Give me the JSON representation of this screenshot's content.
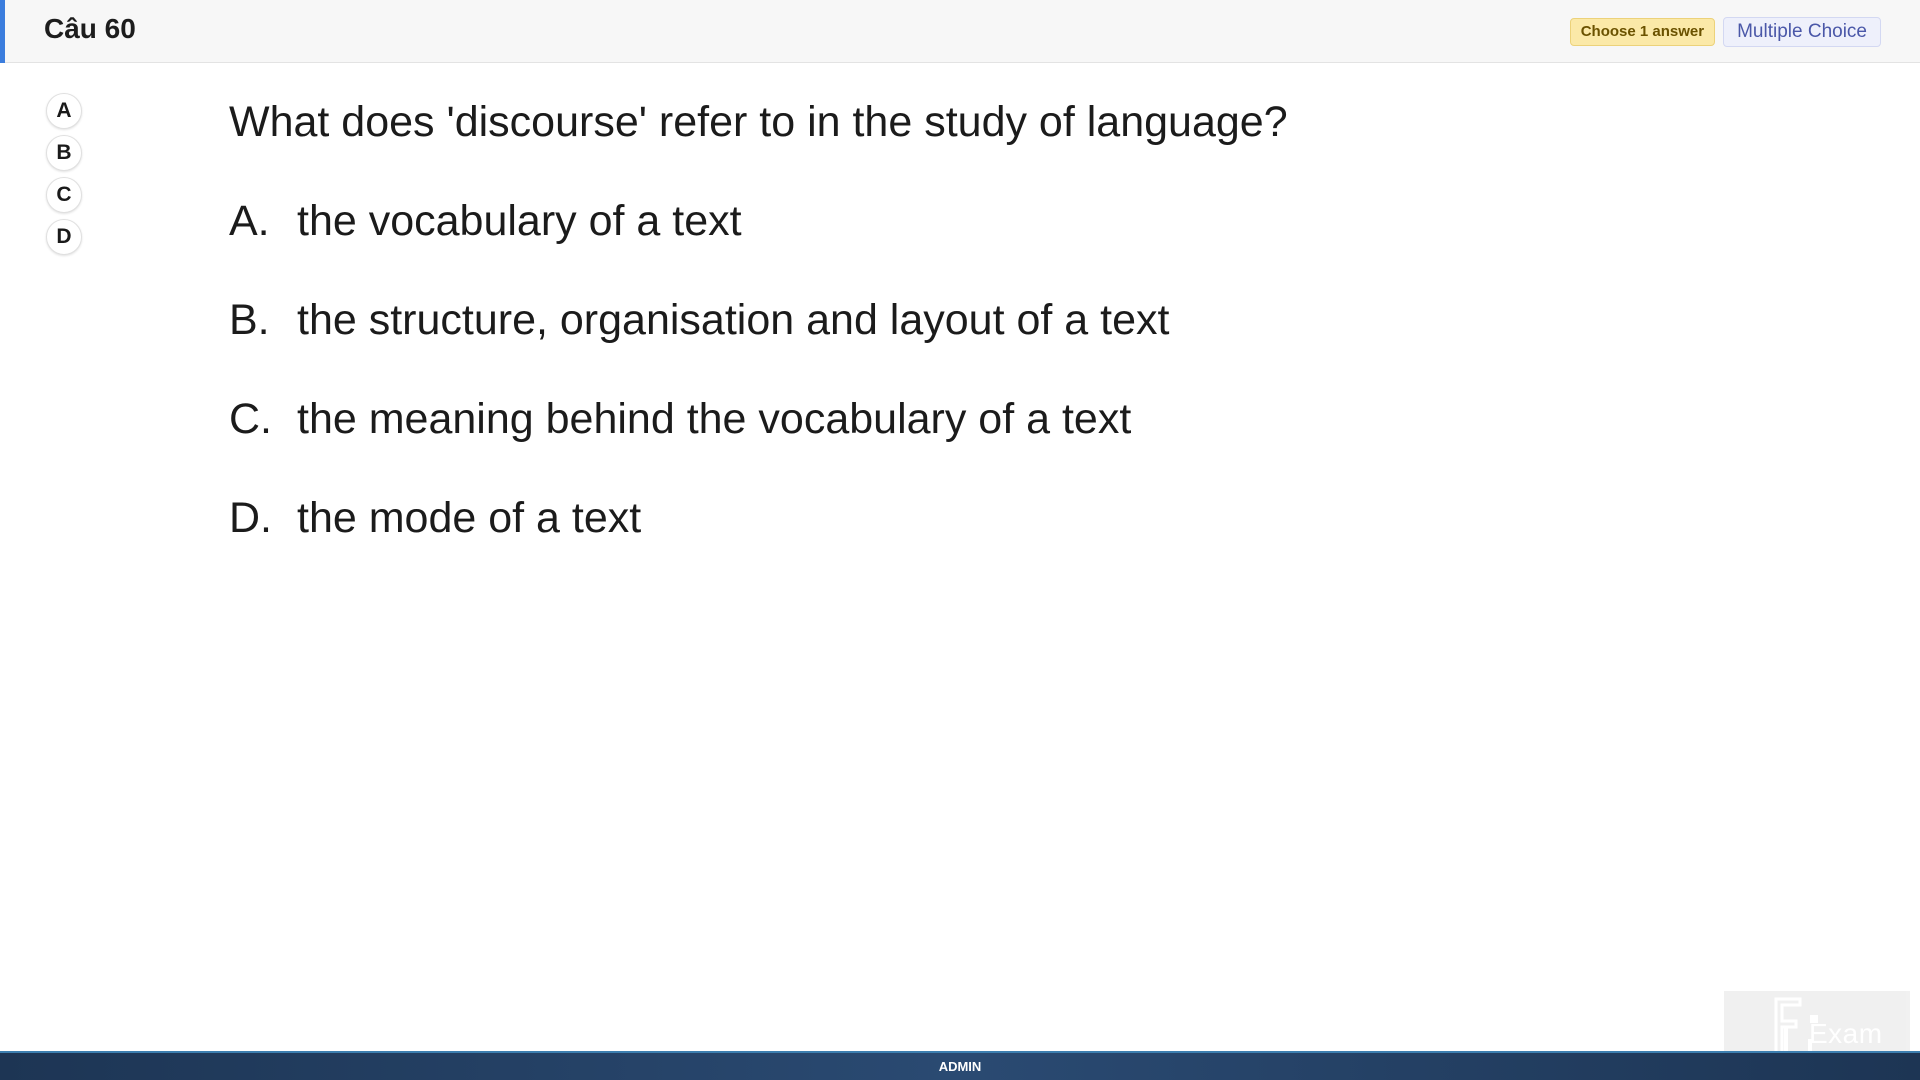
{
  "header": {
    "question_title": "Câu 60",
    "badge_choose": "Choose 1 answer",
    "badge_type": "Multiple Choice"
  },
  "selector": {
    "options": [
      "A",
      "B",
      "C",
      "D"
    ]
  },
  "question": {
    "stem": "What does 'discourse' refer to in the study of language?",
    "options": [
      {
        "letter": "A.",
        "text": "the vocabulary of a text"
      },
      {
        "letter": "B.",
        "text": "the structure, organisation and layout of a text"
      },
      {
        "letter": "C.",
        "text": "the meaning behind the vocabulary of a text"
      },
      {
        "letter": "D.",
        "text": "the mode of a text"
      }
    ]
  },
  "logo": {
    "text": "Exam",
    "icon": "fu-exam-logo"
  },
  "statusbar": {
    "user": "ADMIN"
  },
  "colors": {
    "accent": "#3b7ddd",
    "badge_choose_bg": "#fbe9a8",
    "badge_type_text": "#4a57a8",
    "statusbar_bg": "#1d3554"
  }
}
